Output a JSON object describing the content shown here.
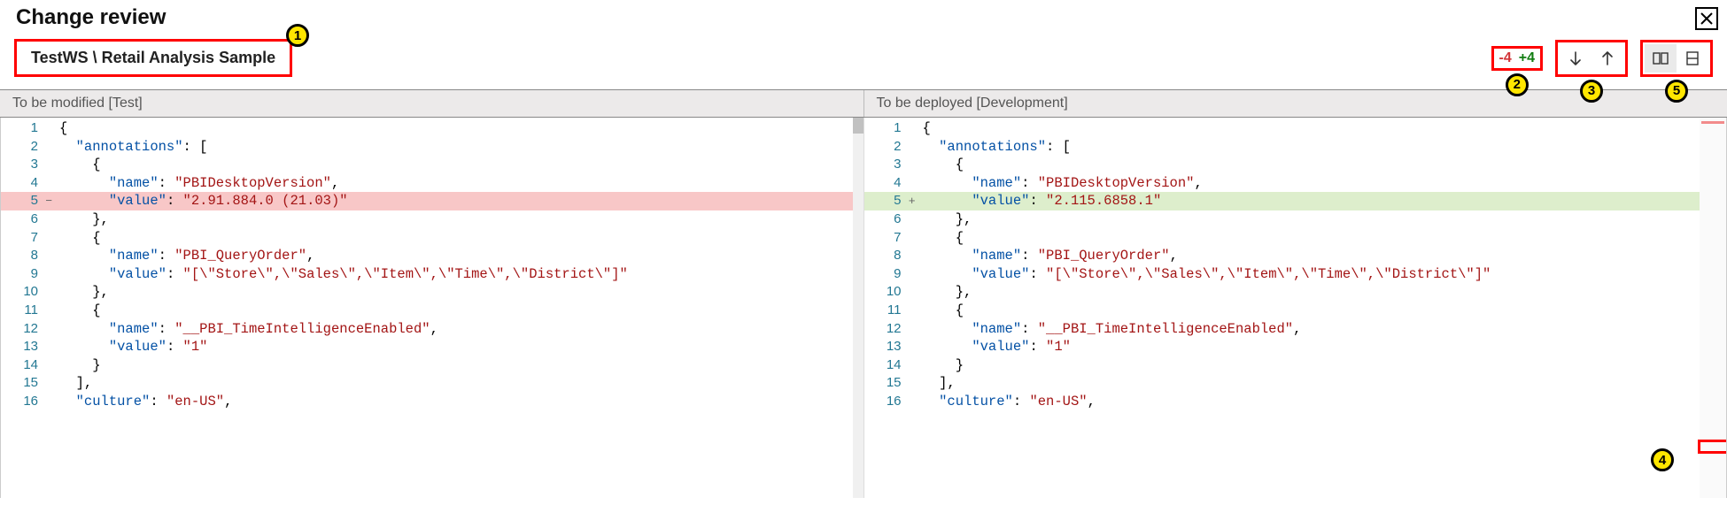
{
  "header": {
    "title": "Change review"
  },
  "breadcrumb": {
    "text": "TestWS \\ Retail Analysis Sample"
  },
  "stats": {
    "removed": "-4",
    "added": "+4"
  },
  "annotations": {
    "a1": "1",
    "a2": "2",
    "a3": "3",
    "a4": "4",
    "a5": "5"
  },
  "panes": {
    "left_title": "To be modified [Test]",
    "right_title": "To be deployed [Development]"
  },
  "icons": {
    "close": "close-icon",
    "arrow_down": "arrow-down-icon",
    "arrow_up": "arrow-up-icon",
    "side_by_side": "side-by-side-icon",
    "inline": "inline-icon"
  },
  "code_left": {
    "lines": [
      {
        "num": "1",
        "marker": "",
        "cls": "",
        "tokens": [
          {
            "t": "{",
            "c": "p"
          }
        ]
      },
      {
        "num": "2",
        "marker": "",
        "cls": "",
        "tokens": [
          {
            "t": "  ",
            "c": "p"
          },
          {
            "t": "\"annotations\"",
            "c": "k"
          },
          {
            "t": ": [",
            "c": "p"
          }
        ]
      },
      {
        "num": "3",
        "marker": "",
        "cls": "",
        "tokens": [
          {
            "t": "    {",
            "c": "p"
          }
        ]
      },
      {
        "num": "4",
        "marker": "",
        "cls": "",
        "tokens": [
          {
            "t": "      ",
            "c": "p"
          },
          {
            "t": "\"name\"",
            "c": "k"
          },
          {
            "t": ": ",
            "c": "p"
          },
          {
            "t": "\"PBIDesktopVersion\"",
            "c": "s"
          },
          {
            "t": ",",
            "c": "p"
          }
        ]
      },
      {
        "num": "5",
        "marker": "−",
        "cls": "del",
        "tokens": [
          {
            "t": "      ",
            "c": "p"
          },
          {
            "t": "\"value\"",
            "c": "k"
          },
          {
            "t": ": ",
            "c": "p"
          },
          {
            "t": "\"2.91.884.0 (21.03)\"",
            "c": "s"
          }
        ]
      },
      {
        "num": "6",
        "marker": "",
        "cls": "",
        "tokens": [
          {
            "t": "    },",
            "c": "p"
          }
        ]
      },
      {
        "num": "7",
        "marker": "",
        "cls": "",
        "tokens": [
          {
            "t": "    {",
            "c": "p"
          }
        ]
      },
      {
        "num": "8",
        "marker": "",
        "cls": "",
        "tokens": [
          {
            "t": "      ",
            "c": "p"
          },
          {
            "t": "\"name\"",
            "c": "k"
          },
          {
            "t": ": ",
            "c": "p"
          },
          {
            "t": "\"PBI_QueryOrder\"",
            "c": "s"
          },
          {
            "t": ",",
            "c": "p"
          }
        ]
      },
      {
        "num": "9",
        "marker": "",
        "cls": "",
        "tokens": [
          {
            "t": "      ",
            "c": "p"
          },
          {
            "t": "\"value\"",
            "c": "k"
          },
          {
            "t": ": ",
            "c": "p"
          },
          {
            "t": "\"[\\\"Store\\\",\\\"Sales\\\",\\\"Item\\\",\\\"Time\\\",\\\"District\\\"]\"",
            "c": "s"
          }
        ]
      },
      {
        "num": "10",
        "marker": "",
        "cls": "",
        "tokens": [
          {
            "t": "    },",
            "c": "p"
          }
        ]
      },
      {
        "num": "11",
        "marker": "",
        "cls": "",
        "tokens": [
          {
            "t": "    {",
            "c": "p"
          }
        ]
      },
      {
        "num": "12",
        "marker": "",
        "cls": "",
        "tokens": [
          {
            "t": "      ",
            "c": "p"
          },
          {
            "t": "\"name\"",
            "c": "k"
          },
          {
            "t": ": ",
            "c": "p"
          },
          {
            "t": "\"__PBI_TimeIntelligenceEnabled\"",
            "c": "s"
          },
          {
            "t": ",",
            "c": "p"
          }
        ]
      },
      {
        "num": "13",
        "marker": "",
        "cls": "",
        "tokens": [
          {
            "t": "      ",
            "c": "p"
          },
          {
            "t": "\"value\"",
            "c": "k"
          },
          {
            "t": ": ",
            "c": "p"
          },
          {
            "t": "\"1\"",
            "c": "s"
          }
        ]
      },
      {
        "num": "14",
        "marker": "",
        "cls": "",
        "tokens": [
          {
            "t": "    }",
            "c": "p"
          }
        ]
      },
      {
        "num": "15",
        "marker": "",
        "cls": "",
        "tokens": [
          {
            "t": "  ],",
            "c": "p"
          }
        ]
      },
      {
        "num": "16",
        "marker": "",
        "cls": "",
        "tokens": [
          {
            "t": "  ",
            "c": "p"
          },
          {
            "t": "\"culture\"",
            "c": "k"
          },
          {
            "t": ": ",
            "c": "p"
          },
          {
            "t": "\"en-US\"",
            "c": "s"
          },
          {
            "t": ",",
            "c": "p"
          }
        ]
      }
    ]
  },
  "code_right": {
    "lines": [
      {
        "num": "1",
        "marker": "",
        "cls": "",
        "tokens": [
          {
            "t": "{",
            "c": "p"
          }
        ]
      },
      {
        "num": "2",
        "marker": "",
        "cls": "",
        "tokens": [
          {
            "t": "  ",
            "c": "p"
          },
          {
            "t": "\"annotations\"",
            "c": "k"
          },
          {
            "t": ": [",
            "c": "p"
          }
        ]
      },
      {
        "num": "3",
        "marker": "",
        "cls": "",
        "tokens": [
          {
            "t": "    {",
            "c": "p"
          }
        ]
      },
      {
        "num": "4",
        "marker": "",
        "cls": "",
        "tokens": [
          {
            "t": "      ",
            "c": "p"
          },
          {
            "t": "\"name\"",
            "c": "k"
          },
          {
            "t": ": ",
            "c": "p"
          },
          {
            "t": "\"PBIDesktopVersion\"",
            "c": "s"
          },
          {
            "t": ",",
            "c": "p"
          }
        ]
      },
      {
        "num": "5",
        "marker": "+",
        "cls": "add",
        "tokens": [
          {
            "t": "      ",
            "c": "p"
          },
          {
            "t": "\"value\"",
            "c": "k"
          },
          {
            "t": ": ",
            "c": "p"
          },
          {
            "t": "\"2.115.6858.1\"",
            "c": "s"
          }
        ]
      },
      {
        "num": "6",
        "marker": "",
        "cls": "",
        "tokens": [
          {
            "t": "    },",
            "c": "p"
          }
        ]
      },
      {
        "num": "7",
        "marker": "",
        "cls": "",
        "tokens": [
          {
            "t": "    {",
            "c": "p"
          }
        ]
      },
      {
        "num": "8",
        "marker": "",
        "cls": "",
        "tokens": [
          {
            "t": "      ",
            "c": "p"
          },
          {
            "t": "\"name\"",
            "c": "k"
          },
          {
            "t": ": ",
            "c": "p"
          },
          {
            "t": "\"PBI_QueryOrder\"",
            "c": "s"
          },
          {
            "t": ",",
            "c": "p"
          }
        ]
      },
      {
        "num": "9",
        "marker": "",
        "cls": "",
        "tokens": [
          {
            "t": "      ",
            "c": "p"
          },
          {
            "t": "\"value\"",
            "c": "k"
          },
          {
            "t": ": ",
            "c": "p"
          },
          {
            "t": "\"[\\\"Store\\\",\\\"Sales\\\",\\\"Item\\\",\\\"Time\\\",\\\"District\\\"]\"",
            "c": "s"
          }
        ]
      },
      {
        "num": "10",
        "marker": "",
        "cls": "",
        "tokens": [
          {
            "t": "    },",
            "c": "p"
          }
        ]
      },
      {
        "num": "11",
        "marker": "",
        "cls": "",
        "tokens": [
          {
            "t": "    {",
            "c": "p"
          }
        ]
      },
      {
        "num": "12",
        "marker": "",
        "cls": "",
        "tokens": [
          {
            "t": "      ",
            "c": "p"
          },
          {
            "t": "\"name\"",
            "c": "k"
          },
          {
            "t": ": ",
            "c": "p"
          },
          {
            "t": "\"__PBI_TimeIntelligenceEnabled\"",
            "c": "s"
          },
          {
            "t": ",",
            "c": "p"
          }
        ]
      },
      {
        "num": "13",
        "marker": "",
        "cls": "",
        "tokens": [
          {
            "t": "      ",
            "c": "p"
          },
          {
            "t": "\"value\"",
            "c": "k"
          },
          {
            "t": ": ",
            "c": "p"
          },
          {
            "t": "\"1\"",
            "c": "s"
          }
        ]
      },
      {
        "num": "14",
        "marker": "",
        "cls": "",
        "tokens": [
          {
            "t": "    }",
            "c": "p"
          }
        ]
      },
      {
        "num": "15",
        "marker": "",
        "cls": "",
        "tokens": [
          {
            "t": "  ],",
            "c": "p"
          }
        ]
      },
      {
        "num": "16",
        "marker": "",
        "cls": "",
        "tokens": [
          {
            "t": "  ",
            "c": "p"
          },
          {
            "t": "\"culture\"",
            "c": "k"
          },
          {
            "t": ": ",
            "c": "p"
          },
          {
            "t": "\"en-US\"",
            "c": "s"
          },
          {
            "t": ",",
            "c": "p"
          }
        ]
      }
    ]
  }
}
